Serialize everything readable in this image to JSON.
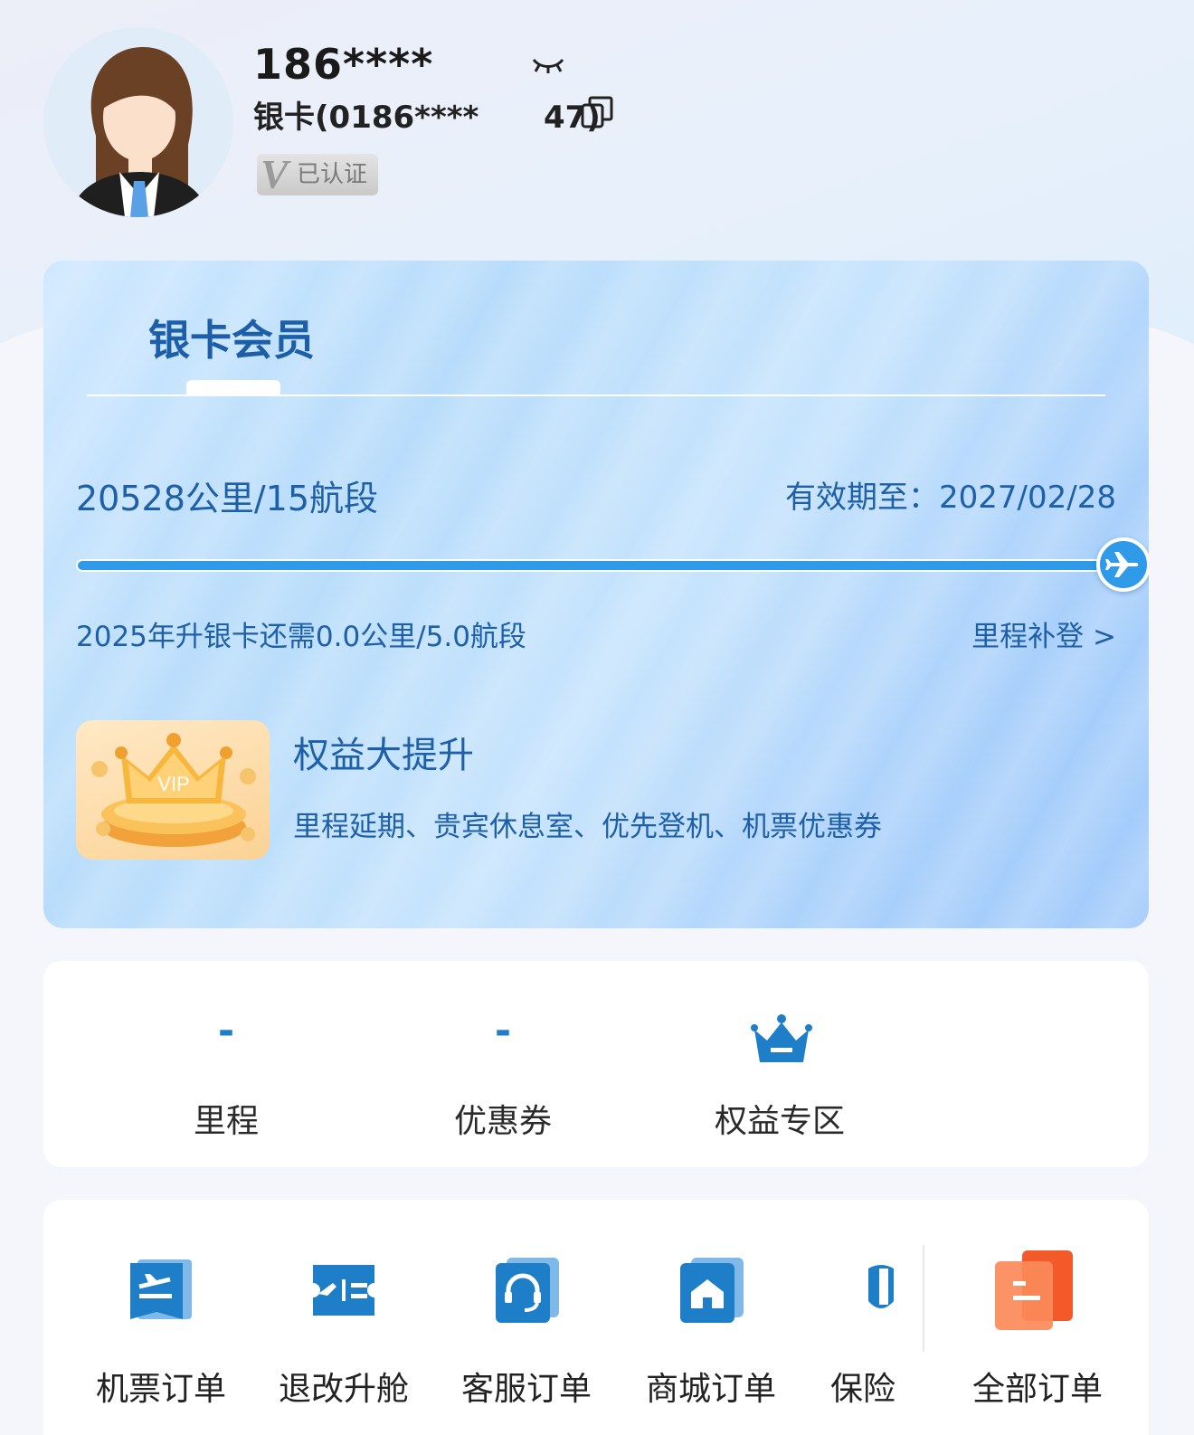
{
  "profile": {
    "phone": "186****",
    "card_number": "银卡(0186****",
    "card_number_tail": "47)",
    "verified_label": "已认证",
    "verified_mark": "V"
  },
  "member": {
    "tier_title": "银卡会员",
    "distance_segments": "20528公里/15航段",
    "expiry": "有效期至：2027/02/28",
    "progress_fraction": 1.0,
    "upgrade_note": "2025年升银卡还需0.0公里/5.0航段",
    "makeup_link": "里程补登 >",
    "benefit_title": "权益大提升",
    "benefit_desc": "里程延期、贵宾休息室、优先登机、机票优惠券",
    "vip_text": "VIP"
  },
  "stats": [
    {
      "value": "-",
      "label": "里程"
    },
    {
      "value": "-",
      "label": "优惠券"
    },
    {
      "value": "",
      "label": "权益专区"
    }
  ],
  "orders": [
    {
      "label": "机票订单",
      "icon": "ticket-icon"
    },
    {
      "label": "退改升舱",
      "icon": "change-icon"
    },
    {
      "label": "客服订单",
      "icon": "headset-icon"
    },
    {
      "label": "商城订单",
      "icon": "shop-icon"
    },
    {
      "label": "保险",
      "icon": "insurance-icon"
    }
  ],
  "all_orders_label": "全部订单",
  "colors": {
    "accent": "#1e7ec8",
    "card_text": "#1d5fa8",
    "progress": "#2e9ae8",
    "all_orders_icon": "#f25a2a"
  }
}
